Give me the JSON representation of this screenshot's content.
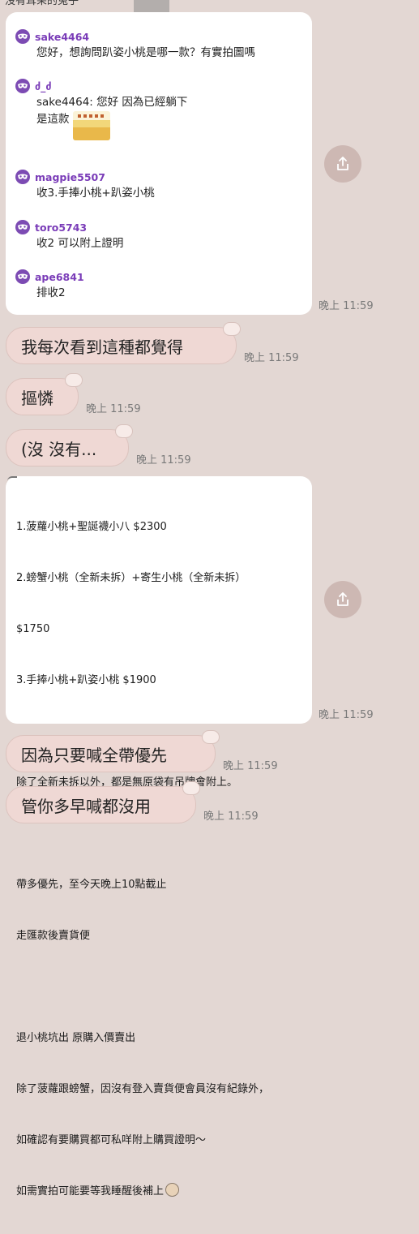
{
  "header": {
    "sender_name": "沒有耳朵的兔子"
  },
  "card_a": {
    "comments": [
      {
        "user": "sake4464",
        "text": "您好，想詢問趴姿小桃是哪一款？有實拍圖嗎"
      },
      {
        "user": "ძ_ძ",
        "line1": "sake4464: 您好 因為已經躺下",
        "line2": "是這款"
      },
      {
        "user": "magpie5507",
        "text": "收3.手捧小桃+趴姿小桃"
      },
      {
        "user": "toro5743",
        "text": "收2 可以附上證明"
      },
      {
        "user": "ape6841",
        "text": "排收2"
      }
    ],
    "time": "晚上 11:59"
  },
  "bubbles": [
    {
      "text": "我每次看到這種都覺得",
      "time": "晚上 11:59"
    },
    {
      "text": "摳憐",
      "time": "晚上 11:59"
    },
    {
      "text": "(沒 沒有...",
      "time": "晚上 11:59"
    }
  ],
  "card_b": {
    "lines": [
      "1.菠蘿小桃+聖誕襪小八 $2300",
      "2.螃蟹小桃（全新未拆）+寄生小桃（全新未拆）",
      "$1750",
      "3.手捧小桃+趴姿小桃 $1900",
      "",
      "除了全新未拆以外，都是無原袋有吊牌會附上。",
      "",
      "帶多優先，至今天晚上10點截止",
      "走匯款後賣貨便",
      "",
      "退小桃坑出 原購入價賣出",
      "除了菠蘿跟螃蟹，因沒有登入賣貨便會員沒有紀錄外，",
      "如確認有要購買都可私咩附上購買證明～",
      "如需實拍可能要等我睡醒後補上"
    ],
    "time": "晚上 11:59"
  },
  "bubbles_bottom": [
    {
      "text": "因為只要喊全帶優先",
      "time": "晚上 11:59"
    },
    {
      "text": "管你多早喊都沒用",
      "time": "晚上 11:59"
    }
  ],
  "icons": {
    "avatar": "mask-icon",
    "share": "share-icon",
    "emoji": "face-emoji-icon"
  },
  "colors": {
    "background": "#e3d7d3",
    "bubble": "#efd8d4",
    "username": "#7a3cb8",
    "share_button": "#cdb8b3"
  }
}
